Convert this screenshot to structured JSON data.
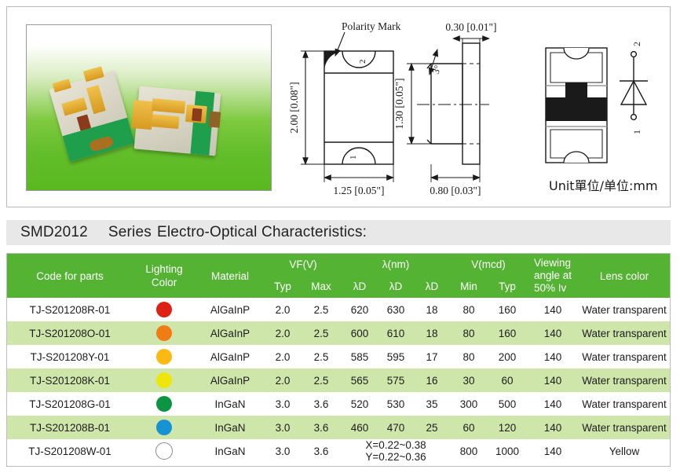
{
  "datasheet": {
    "photo": {
      "caption": "smd-led-photo"
    },
    "drawing": {
      "polarity_label": "Polarity Mark",
      "dim_height": "2.00 [0.08\"]",
      "dim_width": "1.25 [0.05\"]",
      "dim_thickness": "0.30 [0.01\"]",
      "dim_side_height": "1.30 [0.05\"]",
      "dim_side_width": "0.80 [0.03\"]",
      "angle_label": "3°",
      "pin_top": "2",
      "pin_bottom": "1",
      "pad_top": "2",
      "pad_bottom": "1",
      "unit_note": "Unit單位/单位:mm"
    },
    "section_title": {
      "part": "SMD2012",
      "series": "Series",
      "rest": "Electro-Optical Characteristics:"
    },
    "table": {
      "headers": {
        "code": "Code for parts",
        "lighting_color": "Lighting\nColor",
        "material": "Material",
        "vf_group": "VF(V)",
        "vf_typ": "Typ",
        "vf_max": "Max",
        "lambda_group": "λ(nm)",
        "lambda_1": "λD",
        "lambda_2": "λD",
        "lambda_3": "λD",
        "v_group": "V(mcd)",
        "v_min": "Min",
        "v_typ": "Typ",
        "viewing_angle": "Viewing\nangle at\n50% Iv",
        "lens_color": "Lens color"
      },
      "rows": [
        {
          "code": "TJ-S201208R-01",
          "color_hex": "#dd2115",
          "material": "AlGaInP",
          "vf_typ": "2.0",
          "vf_max": "2.5",
          "ld1": "620",
          "ld2": "630",
          "ld3": "18",
          "vmin": "80",
          "vtyp": "160",
          "angle": "140",
          "lens": "Water transparent"
        },
        {
          "code": "TJ-S201208O-01",
          "color_hex": "#ef7c14",
          "material": "AlGaInP",
          "vf_typ": "2.0",
          "vf_max": "2.5",
          "ld1": "600",
          "ld2": "610",
          "ld3": "18",
          "vmin": "80",
          "vtyp": "160",
          "angle": "140",
          "lens": "Water transparent"
        },
        {
          "code": "TJ-S201208Y-01",
          "color_hex": "#fcb913",
          "material": "AlGaInP",
          "vf_typ": "2.0",
          "vf_max": "2.5",
          "ld1": "585",
          "ld2": "595",
          "ld3": "17",
          "vmin": "80",
          "vtyp": "200",
          "angle": "140",
          "lens": "Water transparent"
        },
        {
          "code": "TJ-S201208K-01",
          "color_hex": "#eee60b",
          "material": "AlGaInP",
          "vf_typ": "2.0",
          "vf_max": "2.5",
          "ld1": "565",
          "ld2": "575",
          "ld3": "16",
          "vmin": "30",
          "vtyp": "60",
          "angle": "140",
          "lens": "Water transparent"
        },
        {
          "code": "TJ-S201208G-01",
          "color_hex": "#0b9444",
          "material": "InGaN",
          "vf_typ": "3.0",
          "vf_max": "3.6",
          "ld1": "520",
          "ld2": "530",
          "ld3": "35",
          "vmin": "300",
          "vtyp": "500",
          "angle": "140",
          "lens": "Water transparent"
        },
        {
          "code": "TJ-S201208B-01",
          "color_hex": "#1793d4",
          "material": "InGaN",
          "vf_typ": "3.0",
          "vf_max": "3.6",
          "ld1": "460",
          "ld2": "470",
          "ld3": "25",
          "vmin": "60",
          "vtyp": "120",
          "angle": "140",
          "lens": "Water transparent"
        },
        {
          "code": "TJ-S201208W-01",
          "color_hex": "#ffffff",
          "material": "InGaN",
          "vf_typ": "3.0",
          "vf_max": "3.6",
          "cie": "X=0.22~0.38\nY=0.22~0.36",
          "vmin": "800",
          "vtyp": "1000",
          "angle": "140",
          "lens": "Yellow"
        }
      ]
    },
    "colors": {
      "header_green": "#55b334",
      "row_alt_green": "#cfe6ab",
      "title_bar_gray": "#e8e8e8"
    }
  }
}
